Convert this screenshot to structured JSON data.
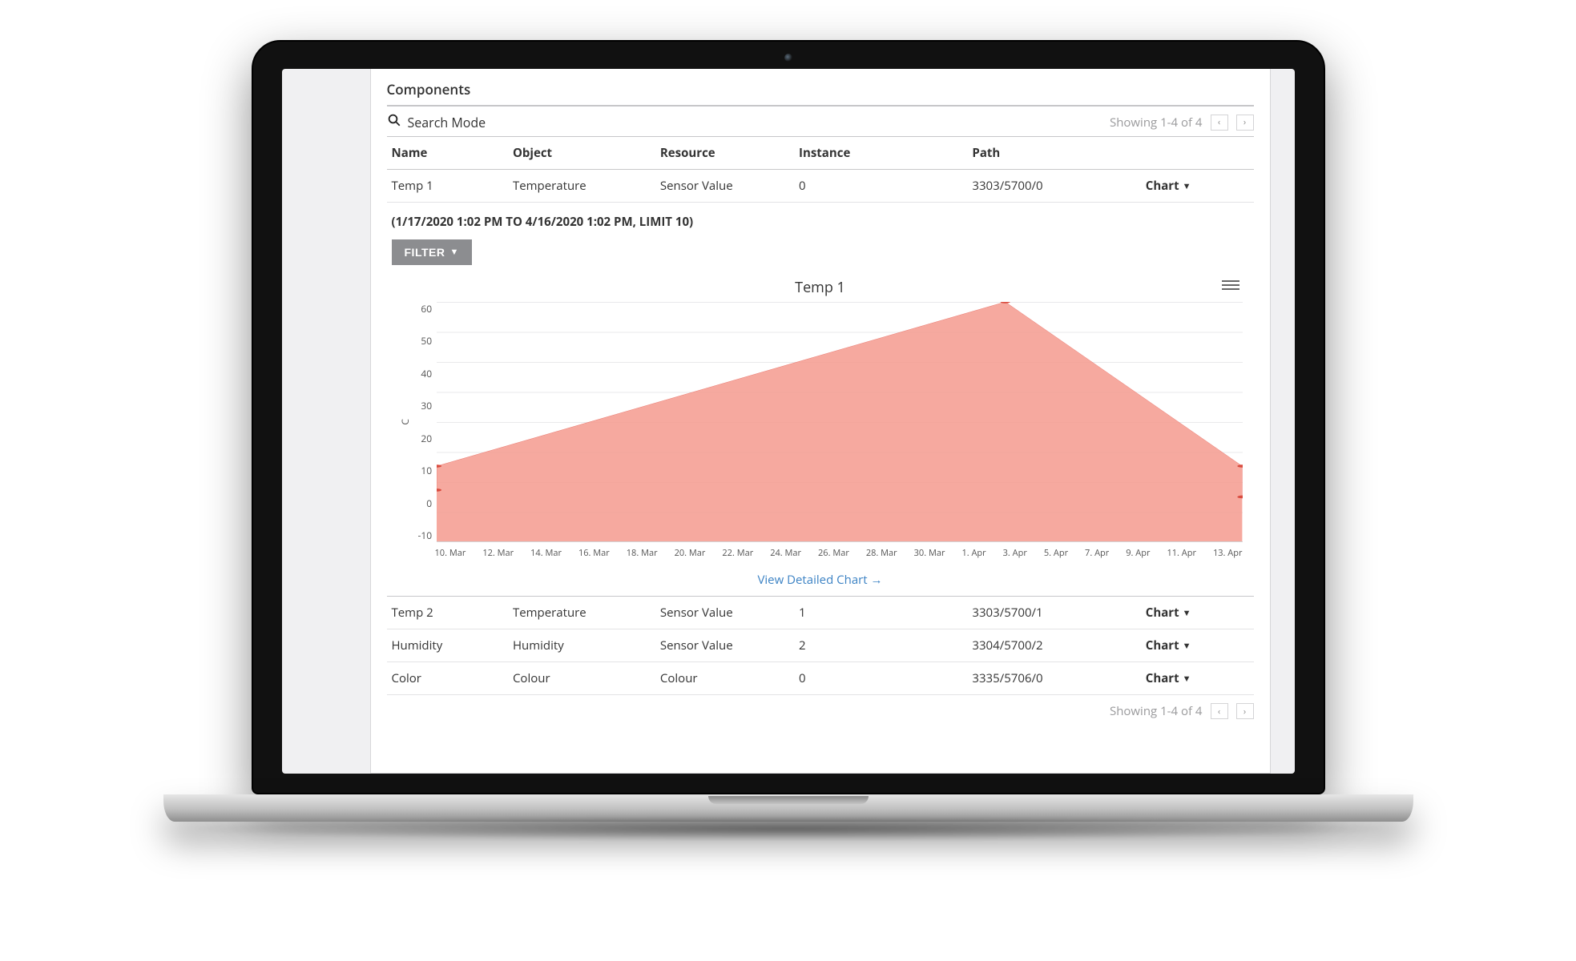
{
  "panel_title": "Components",
  "search_mode_label": "Search Mode",
  "showing_text": "Showing 1-4 of 4",
  "columns": {
    "name": "Name",
    "object": "Object",
    "resource": "Resource",
    "instance": "Instance",
    "path": "Path"
  },
  "action_label": "Chart",
  "rows": [
    {
      "name": "Temp 1",
      "object": "Temperature",
      "resource": "Sensor Value",
      "instance": "0",
      "path": "3303/5700/0"
    },
    {
      "name": "Temp 2",
      "object": "Temperature",
      "resource": "Sensor Value",
      "instance": "1",
      "path": "3303/5700/1"
    },
    {
      "name": "Humidity",
      "object": "Humidity",
      "resource": "Sensor Value",
      "instance": "2",
      "path": "3304/5700/2"
    },
    {
      "name": "Color",
      "object": "Colour",
      "resource": "Colour",
      "instance": "0",
      "path": "3335/5706/0"
    }
  ],
  "expanded": {
    "range_label": "(1/17/2020 1:02 PM TO 4/16/2020 1:02 PM, LIMIT 10)",
    "filter_label": "FILTER",
    "detail_link": "View Detailed Chart →"
  },
  "chart_data": {
    "type": "area",
    "title": "Temp 1",
    "ylabel": "C",
    "ylim": [
      -10,
      60
    ],
    "y_ticks": [
      60,
      50,
      40,
      30,
      20,
      10,
      0,
      -10
    ],
    "x_ticks": [
      "10. Mar",
      "12. Mar",
      "14. Mar",
      "16. Mar",
      "18. Mar",
      "20. Mar",
      "22. Mar",
      "24. Mar",
      "26. Mar",
      "28. Mar",
      "30. Mar",
      "1. Apr",
      "3. Apr",
      "5. Apr",
      "7. Apr",
      "9. Apr",
      "11. Apr",
      "13. Apr"
    ],
    "series": [
      {
        "name": "Temp 1",
        "color": "#f59a8e",
        "points": [
          {
            "x": "10. Mar",
            "y": 5
          },
          {
            "x": "10. Mar",
            "y": 12
          },
          {
            "x": "3. Apr",
            "y": 60
          },
          {
            "x": "13. Apr",
            "y": 12
          },
          {
            "x": "13. Apr",
            "y": 3
          }
        ]
      }
    ]
  }
}
